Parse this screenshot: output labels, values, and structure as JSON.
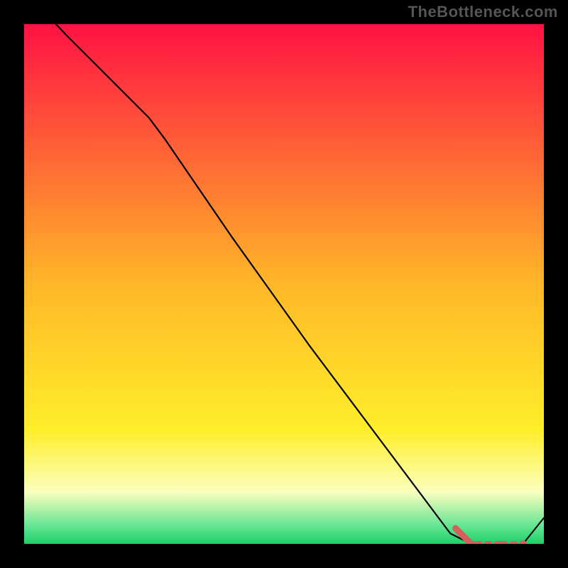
{
  "watermark": {
    "text": "TheBottleneck.com"
  },
  "colors": {
    "background": "#000000",
    "line": "#000000",
    "dash": "#d55e5e",
    "series_b": "#d55e5e",
    "watermark": "#555555"
  },
  "chart_data": {
    "type": "line",
    "title": "",
    "xlabel": "",
    "ylabel": "",
    "xlim": [
      0,
      100
    ],
    "ylim": [
      0,
      100
    ],
    "gradient_stops": [
      {
        "offset": 0.0,
        "color": "#ff1243"
      },
      {
        "offset": 0.5,
        "color": "#ffb728"
      },
      {
        "offset": 0.78,
        "color": "#ffee2a"
      },
      {
        "offset": 0.9,
        "color": "#fbffbe"
      },
      {
        "offset": 0.965,
        "color": "#65e594"
      },
      {
        "offset": 1.0,
        "color": "#1dd168"
      }
    ],
    "series": [
      {
        "name": "main-curve",
        "style": "solid",
        "color": "#000000",
        "x": [
          0.5,
          8,
          16,
          24,
          27,
          40,
          55,
          70,
          82,
          86,
          88
        ],
        "y": [
          106,
          98,
          90,
          82,
          78,
          59,
          38,
          18,
          2,
          0,
          0
        ]
      },
      {
        "name": "tail-reference",
        "style": "dashed",
        "color": "#d55e5e",
        "x": [
          86,
          88,
          90,
          92,
          94,
          96
        ],
        "y": [
          0,
          0,
          0,
          0,
          0,
          0
        ]
      },
      {
        "name": "corner-rise",
        "style": "solid",
        "color": "#000000",
        "x": [
          96,
          100
        ],
        "y": [
          0,
          5
        ]
      }
    ],
    "markers": [
      {
        "name": "end-dot",
        "x": 96,
        "y": 0,
        "color": "#d55e5e",
        "r": 5
      }
    ]
  }
}
